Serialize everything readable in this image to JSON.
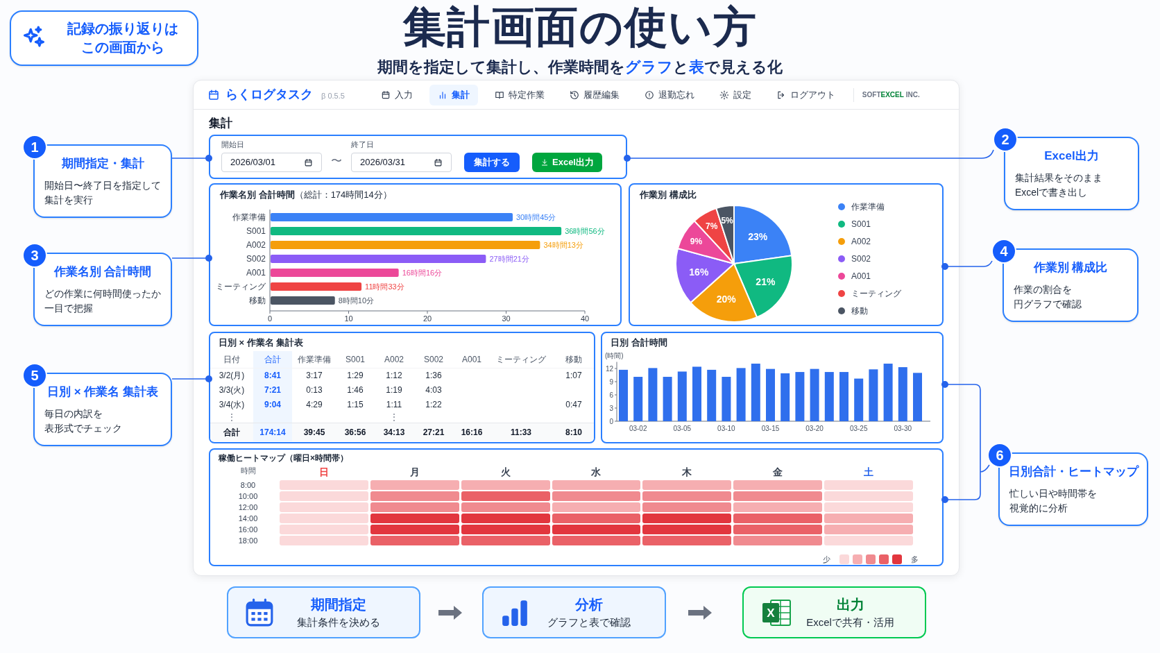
{
  "header": {
    "title": "集計画面の使い方",
    "subtitle": "期間を指定して集計し、作業時間を**グラフ**と**表**で見える化"
  },
  "intro_bubble": {
    "lines": [
      "記録の振り返りは",
      "この画面から"
    ]
  },
  "left_callouts": [
    {
      "number": "1",
      "title": "期間指定・集計",
      "lines": [
        "開始日〜終了日を指定して",
        "集計を実行"
      ]
    },
    {
      "number": "3",
      "title": "作業名別 合計時間",
      "lines": [
        "どの作業に何時間使ったか",
        "一目で把握"
      ]
    },
    {
      "number": "5",
      "title": "日別 × 作業名 集計表",
      "lines": [
        "毎日の内訳を",
        "表形式でチェック"
      ]
    }
  ],
  "right_callouts": [
    {
      "number": "2",
      "title": "Excel出力",
      "lines": [
        "集計結果をそのまま",
        "Excelで書き出し"
      ]
    },
    {
      "number": "4",
      "title": "作業別 構成比",
      "lines": [
        "作業の割合を",
        "円グラフで確認"
      ]
    },
    {
      "number": "6",
      "title": "日別合計・ヒートマップ",
      "lines": [
        "忙しい日や時間帯を",
        "視覚的に分析"
      ]
    }
  ],
  "app": {
    "name": "らくログタスク",
    "version": "β 0.5.5",
    "nav": [
      {
        "label": "入力",
        "kind": "calendar",
        "selected": false
      },
      {
        "label": "集計",
        "kind": "chart",
        "selected": true
      },
      {
        "label": "特定作業",
        "kind": "book",
        "selected": false
      },
      {
        "label": "履歴編集",
        "kind": "history",
        "selected": false
      },
      {
        "label": "退勤忘れ",
        "kind": "info",
        "selected": false
      },
      {
        "label": "設定",
        "kind": "gear",
        "selected": false
      },
      {
        "label": "ログアウト",
        "kind": "logout",
        "selected": false
      }
    ],
    "company": "SOFT**EXCEL** INC.",
    "page_title": "集計",
    "filter": {
      "start_label": "開始日",
      "start_value": "2026/03/01",
      "separator": "〜",
      "end_label": "終了日",
      "end_value": "2026/03/31",
      "buttons": [
        {
          "label": "集計する",
          "kind": "primary"
        },
        {
          "label": "Excel出力",
          "kind": "export"
        }
      ]
    },
    "task_totals": {
      "title": "**作業名別 合計時間**（総計：174時間14分）",
      "chart_data": {
        "type": "bar",
        "orientation": "horizontal",
        "categories": [
          "作業準備",
          "S001",
          "A002",
          "S002",
          "A001",
          "ミーティング",
          "移動"
        ],
        "values": [
          30.75,
          36.93,
          34.22,
          27.35,
          16.27,
          11.55,
          8.17
        ],
        "xlim": [
          0,
          40
        ],
        "xticks": [
          0,
          10,
          20,
          30,
          40
        ]
      },
      "duration_labels": [
        "30時間45分",
        "36時間56分",
        "34時間13分",
        "27時間21分",
        "16時間16分",
        "11時間33分",
        "8時間10分"
      ]
    },
    "composition": {
      "title": "作業別 構成比",
      "legend": [
        {
          "label": "作業準備",
          "color": "#3b82f6"
        },
        {
          "label": "S001",
          "color": "#10b981"
        },
        {
          "label": "A002",
          "color": "#f59e0b"
        },
        {
          "label": "S002",
          "color": "#8b5cf6"
        },
        {
          "label": "A001",
          "color": "#ec4899"
        },
        {
          "label": "ミーティング",
          "color": "#ef4444"
        },
        {
          "label": "移動",
          "color": "#4b5563"
        }
      ],
      "chart_data": {
        "type": "pie",
        "values": [
          23,
          21,
          20,
          16,
          9,
          7,
          5
        ],
        "value_labels": [
          "23%",
          "21%",
          "20%",
          "16%",
          "9%",
          "7%",
          "5%"
        ]
      }
    },
    "daily_table": {
      "title": "日別 × 作業名 集計表",
      "columns": [
        {
          "label": "日付",
          "highlighted": false
        },
        {
          "label": "合計",
          "highlighted": true
        },
        {
          "label": "作業準備",
          "highlighted": false
        },
        {
          "label": "S001",
          "highlighted": false
        },
        {
          "label": "A002",
          "highlighted": false
        },
        {
          "label": "S002",
          "highlighted": false
        },
        {
          "label": "A001",
          "highlighted": false
        },
        {
          "label": "ミーティング",
          "highlighted": false
        },
        {
          "label": "移動",
          "highlighted": false
        }
      ],
      "rows": [
        {
          "kind": "day",
          "cells": [
            "3/2(月)",
            "8:41",
            "3:17",
            "1:29",
            "1:12",
            "1:36",
            null,
            null,
            "1:07"
          ]
        },
        {
          "kind": "day",
          "cells": [
            "3/3(火)",
            "7:21",
            "0:13",
            "1:46",
            "1:19",
            "4:03",
            null,
            null,
            null
          ]
        },
        {
          "kind": "day",
          "cells": [
            "3/4(水)",
            "9:04",
            "4:29",
            "1:15",
            "1:11",
            "1:22",
            null,
            null,
            "0:47"
          ]
        },
        {
          "kind": "ellipsis",
          "cells": [
            "⋮",
            null,
            null,
            null,
            "⋮",
            null,
            null,
            null,
            null
          ]
        },
        {
          "kind": "total",
          "cells": [
            "合計",
            "174:14",
            "39:45",
            "36:56",
            "34:13",
            "27:21",
            "16:16",
            "11:33",
            "8:10"
          ]
        }
      ]
    },
    "daily_totals": {
      "title": "日別 合計時間",
      "chart_data": {
        "type": "bar",
        "ylabel": "(時間)",
        "categories": [
          null,
          "03-02",
          null,
          null,
          "03-05",
          null,
          null,
          "03-10",
          null,
          null,
          "03-15",
          null,
          null,
          "03-20",
          null,
          null,
          "03-25",
          null,
          null,
          "03-30",
          null
        ],
        "values": [
          11.7,
          10.1,
          12.1,
          10.1,
          11.3,
          12.4,
          11.7,
          10.1,
          12.1,
          13.1,
          11.9,
          10.9,
          11.2,
          11.9,
          11.2,
          11.2,
          9.7,
          11.8,
          13.1,
          12.3,
          11.0
        ],
        "ylim": [
          0,
          13.5
        ],
        "yticks": [
          0,
          3,
          6,
          9,
          12
        ]
      }
    },
    "heatmap": {
      "title": "稼働ヒートマップ（曜日×時間帯）",
      "time_header": "時間",
      "days": [
        {
          "label": "日",
          "color": "#ef4444"
        },
        {
          "label": "月",
          "color": "#374151"
        },
        {
          "label": "火",
          "color": "#374151"
        },
        {
          "label": "水",
          "color": "#374151"
        },
        {
          "label": "木",
          "color": "#374151"
        },
        {
          "label": "金",
          "color": "#374151"
        },
        {
          "label": "土",
          "color": "#2563eb"
        }
      ],
      "times": [
        "8:00",
        "10:00",
        "12:00",
        "14:00",
        "16:00",
        "18:00"
      ],
      "legend_low": "少",
      "legend_high": "多"
    }
  },
  "flow_steps": [
    {
      "kind": "calendar",
      "title": "期間指定",
      "caption": "集計条件を決める"
    },
    {
      "kind": "chart",
      "title": "分析",
      "caption": "グラフと表で確認"
    },
    {
      "kind": "excel",
      "title": "出力",
      "caption": "Excelで共有・活用",
      "icon_letter": "X"
    }
  ]
}
